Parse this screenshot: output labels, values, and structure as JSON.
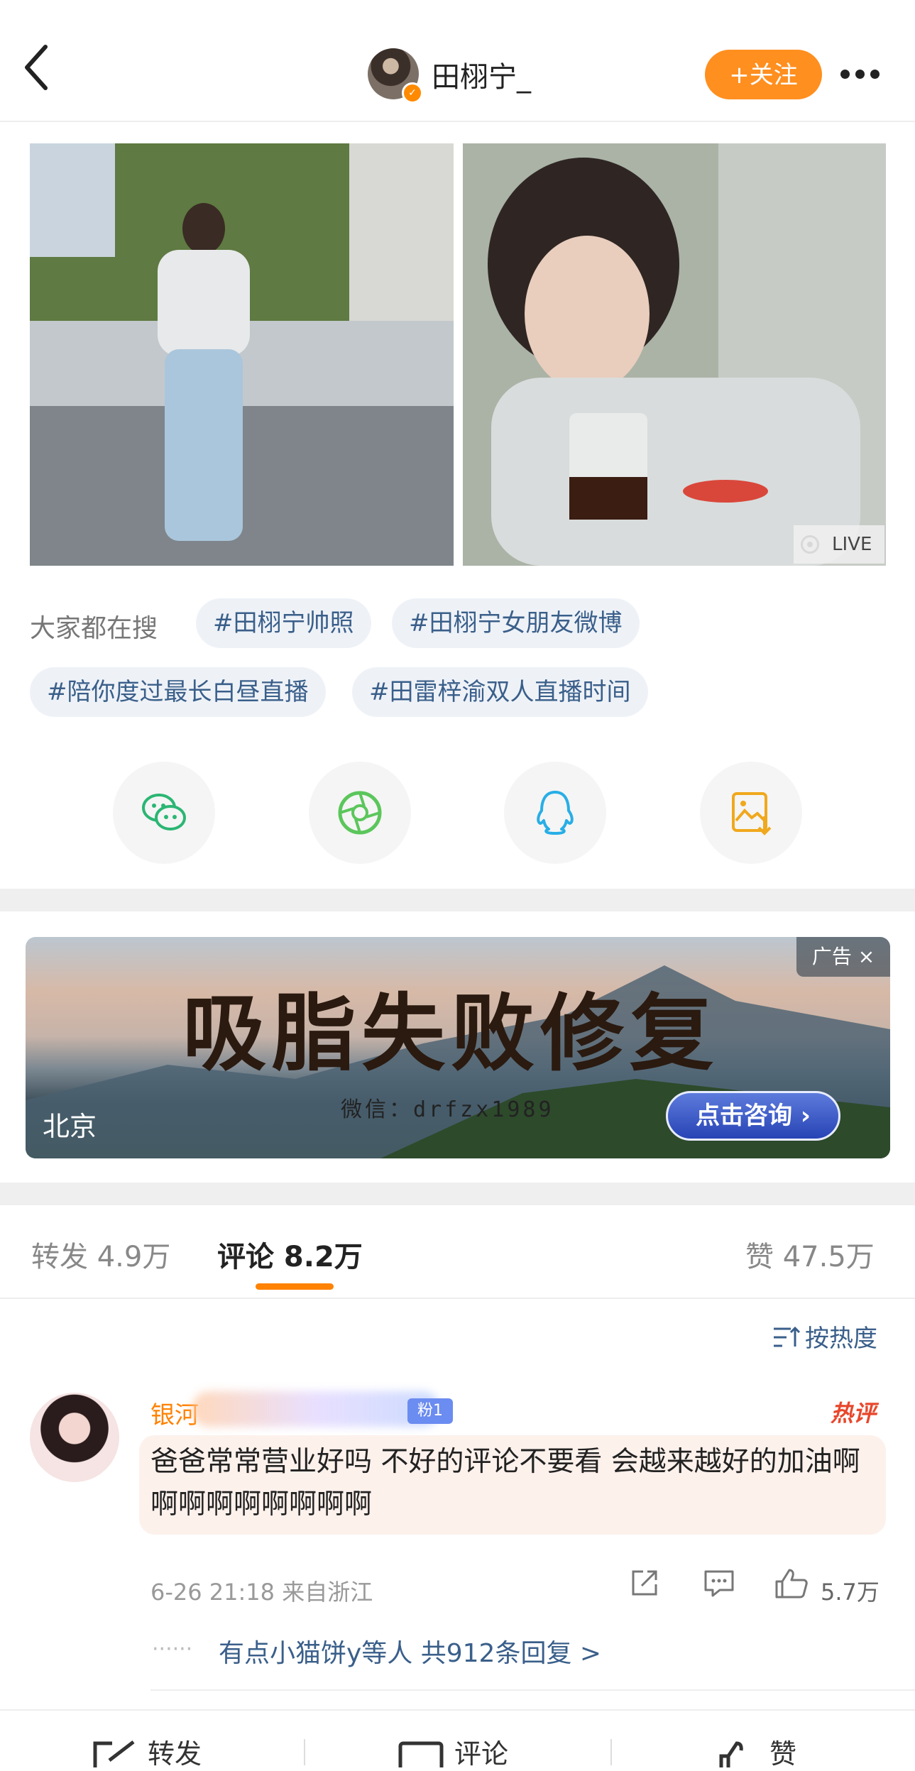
{
  "header": {
    "username": "田栩宁_",
    "follow_label": "+关注",
    "back_icon": "chevron-left-icon",
    "more_icon": "more-dots-icon"
  },
  "photos": {
    "live_label": "LIVE"
  },
  "search": {
    "label": "大家都在搜",
    "chips": [
      "#田栩宁帅照",
      "#田栩宁女朋友微博",
      "#陪你度过最长白昼直播",
      "#田雷梓渝双人直播时间"
    ]
  },
  "share": {
    "icons": [
      "wechat-icon",
      "moments-icon",
      "qq-icon",
      "save-image-icon"
    ]
  },
  "ad": {
    "tag": "广告 ×",
    "title": "吸脂失败修复",
    "wechat": "微信：drfzx1989",
    "button": "点击咨询 ›",
    "location": "北京"
  },
  "tabs": {
    "repost": "转发 4.9万",
    "comment": "评论 8.2万",
    "like": "赞 47.5万"
  },
  "sort": {
    "label": "按热度",
    "icon": "sort-icon"
  },
  "comment": {
    "name_visible": "银河",
    "fan_badge": "粉1",
    "hot_label": "热评",
    "text": "爸爸常常营业好吗 不好的评论不要看 会越来越好的加油啊啊啊啊啊啊啊啊啊",
    "meta": "6-26 21:18  来自浙江",
    "like_count": "5.7万",
    "replies_text": "有点小猫饼y等人  共912条回复 >"
  },
  "bottom_bar": {
    "repost": "转发",
    "comment": "评论",
    "like": "赞"
  },
  "colors": {
    "accent": "#ff8200",
    "link": "#3a5f8a",
    "chip_bg": "#eef2f7"
  }
}
